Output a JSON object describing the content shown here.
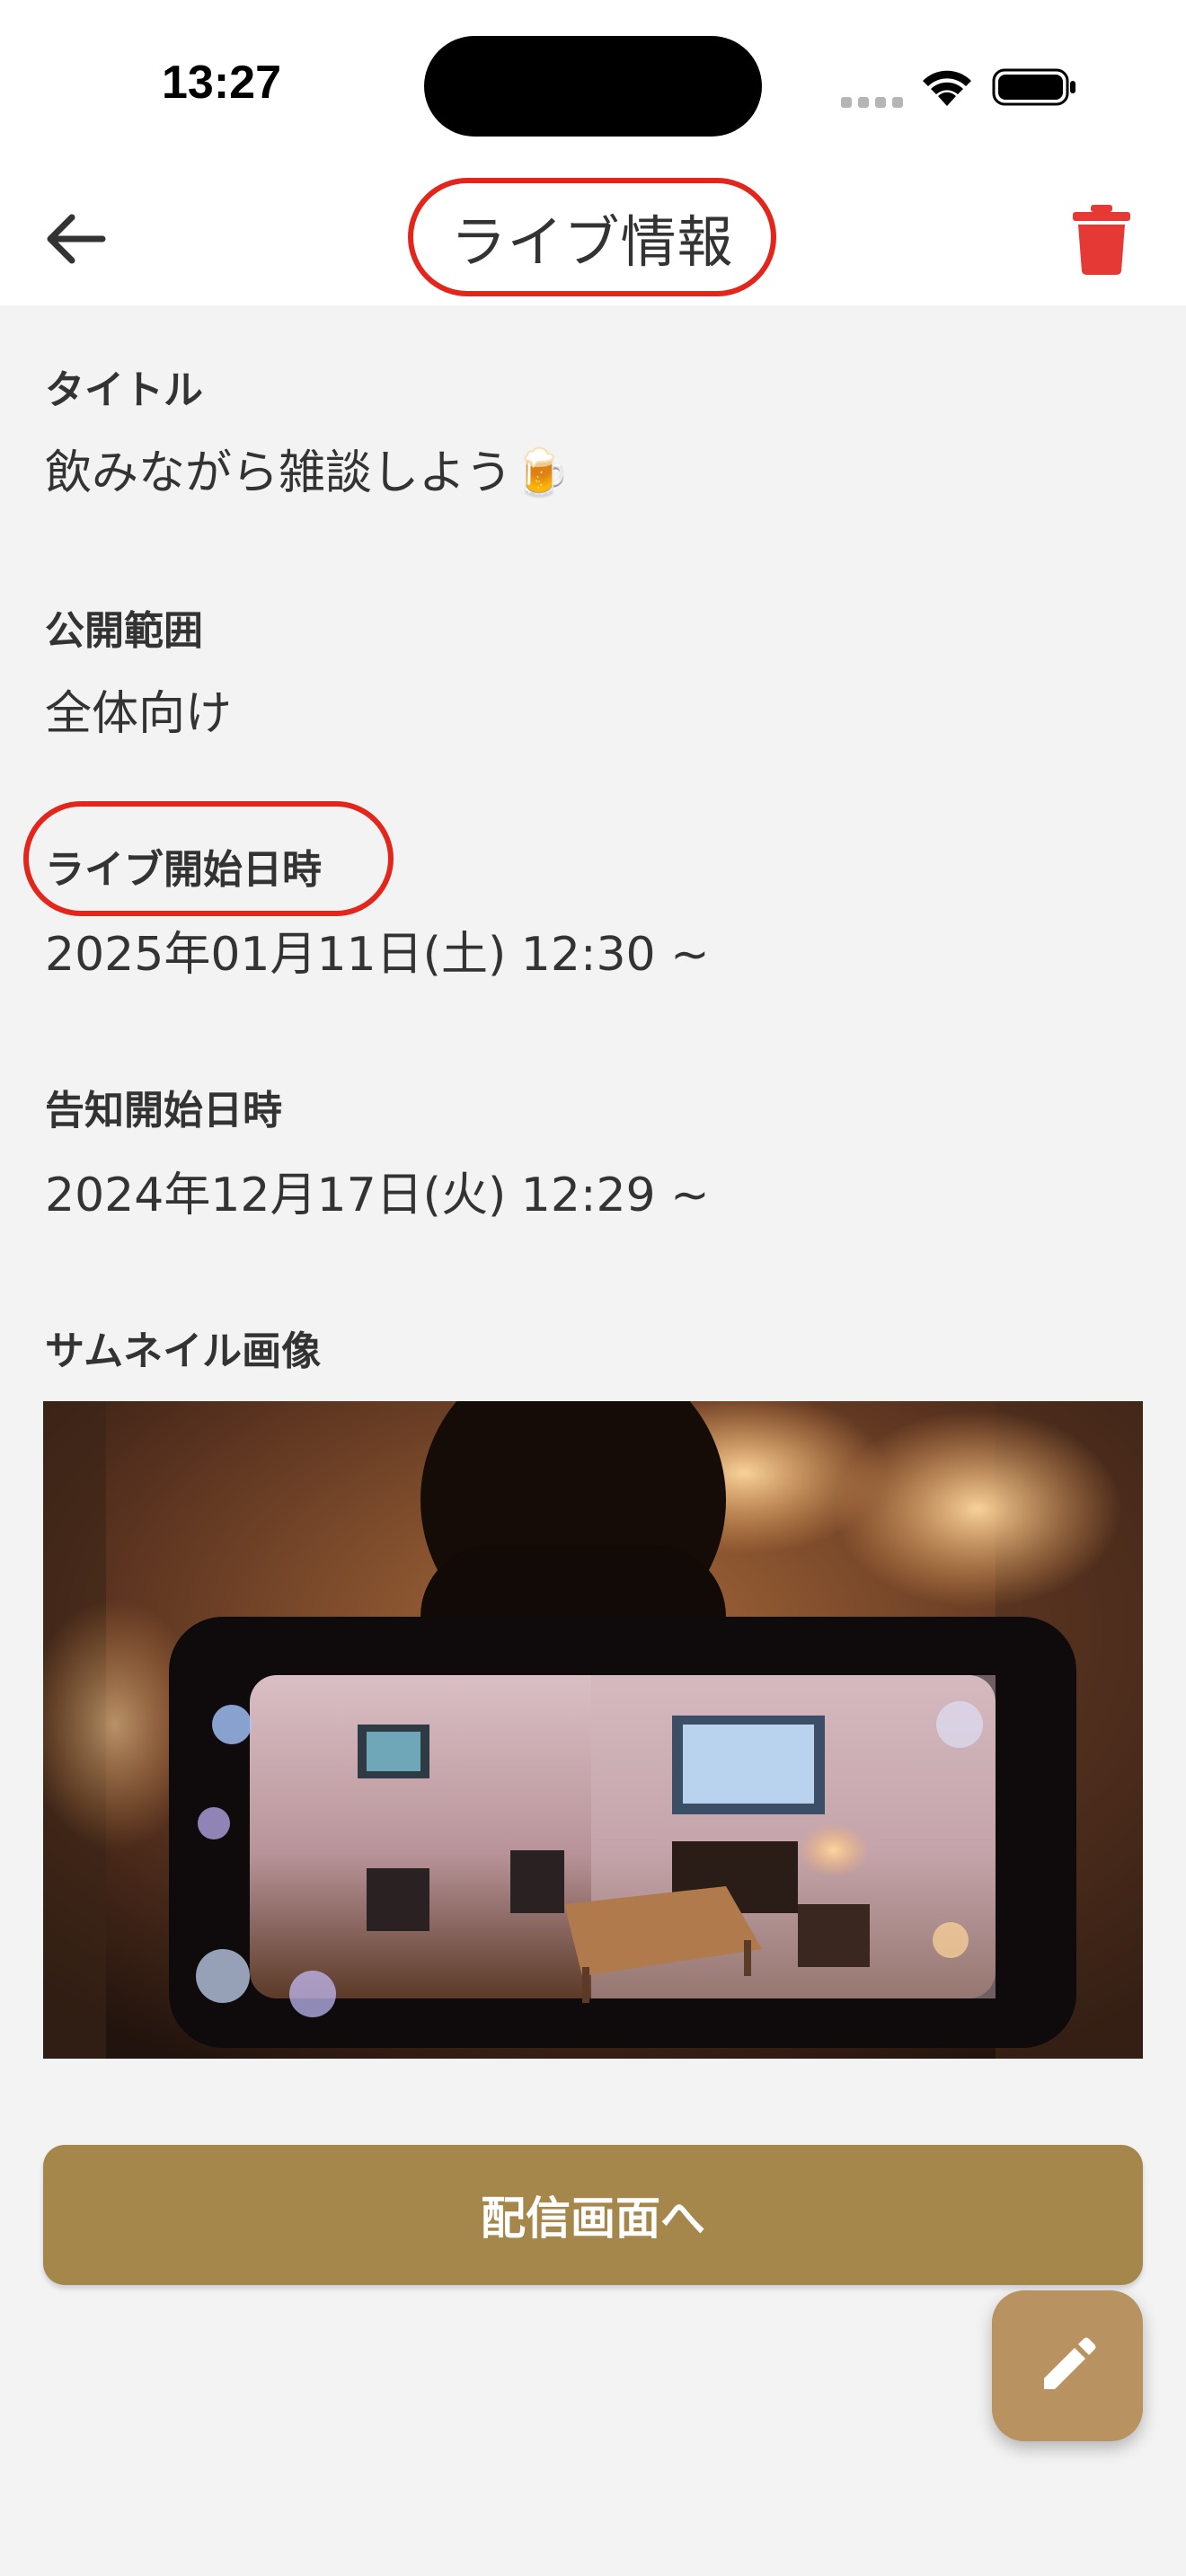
{
  "status_bar": {
    "time": "13:27"
  },
  "nav": {
    "title": "ライブ情報"
  },
  "fields": {
    "title": {
      "label": "タイトル",
      "value": "飲みながら雑談しよう🍺"
    },
    "visibility": {
      "label": "公開範囲",
      "value": "全体向け"
    },
    "live_start": {
      "label": "ライブ開始日時",
      "value": "2025年01月11日(土) 12:30 ~"
    },
    "announce_start": {
      "label": "告知開始日時",
      "value": "2024年12月17日(火) 12:29 ~"
    },
    "thumbnail": {
      "label": "サムネイル画像"
    }
  },
  "actions": {
    "go_to_stream": "配信画面へ"
  },
  "colors": {
    "accent_button": "#a6874b",
    "fab": "#b89260",
    "delete": "#e53935",
    "highlight_ring": "#e3251b"
  },
  "icons": {
    "back": "arrow-left-icon",
    "delete": "trash-icon",
    "edit": "pencil-icon"
  }
}
